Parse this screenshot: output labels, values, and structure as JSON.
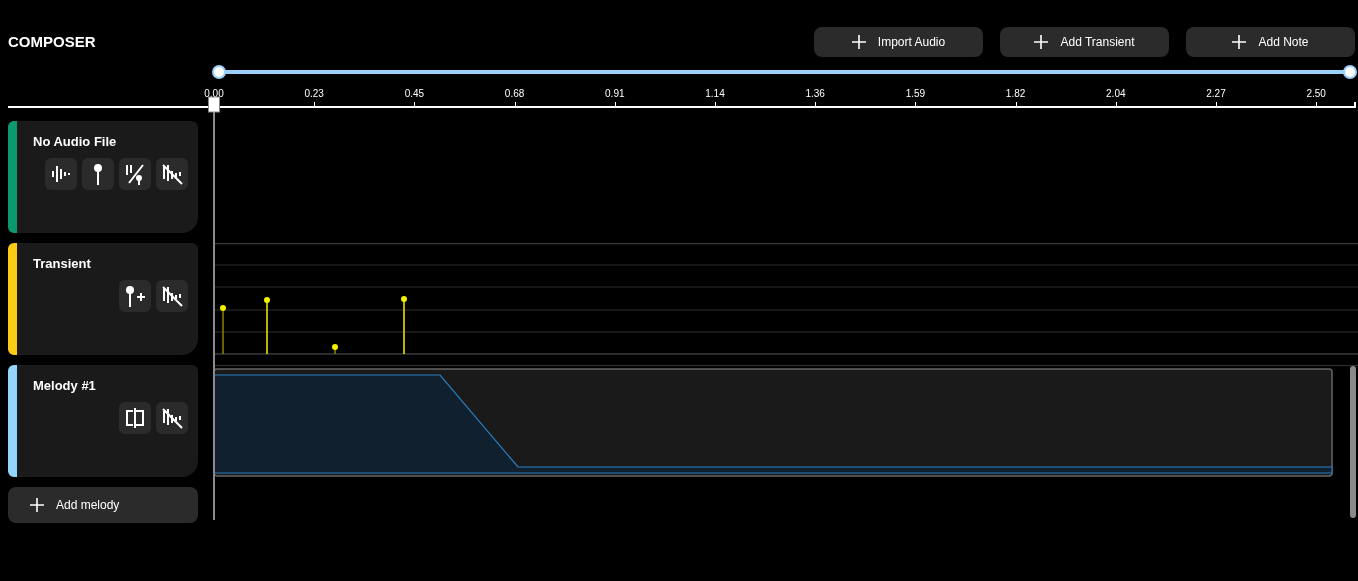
{
  "app": {
    "title": "COMPOSER"
  },
  "toolbar": {
    "buttons": [
      {
        "label": "Import Audio"
      },
      {
        "label": "Add Transient"
      },
      {
        "label": "Add Note"
      }
    ]
  },
  "zoom_slider": {
    "level": 1
  },
  "ruler": {
    "ticks": [
      "0.00",
      "0.23",
      "0.45",
      "0.68",
      "0.91",
      "1.14",
      "1.36",
      "1.59",
      "1.82",
      "2.04",
      "2.27",
      "2.50"
    ]
  },
  "tracks": [
    {
      "name": "No Audio File",
      "kind": "audio",
      "color": "#0b9a6f",
      "tools": [
        {
          "kind": "waveform"
        },
        {
          "kind": "pin"
        },
        {
          "kind": "bars-pin"
        },
        {
          "kind": "hide-waveform"
        }
      ]
    },
    {
      "name": "Transient",
      "kind": "transient",
      "color": "#facc15",
      "tools": [
        {
          "kind": "pin-plus"
        },
        {
          "kind": "hide-waveform"
        }
      ]
    },
    {
      "name": "Melody #1",
      "kind": "melody",
      "color": "#93d5fb",
      "tools": [
        {
          "kind": "split"
        },
        {
          "kind": "hide-waveform"
        }
      ]
    }
  ],
  "add_melody": {
    "label": "Add melody"
  }
}
